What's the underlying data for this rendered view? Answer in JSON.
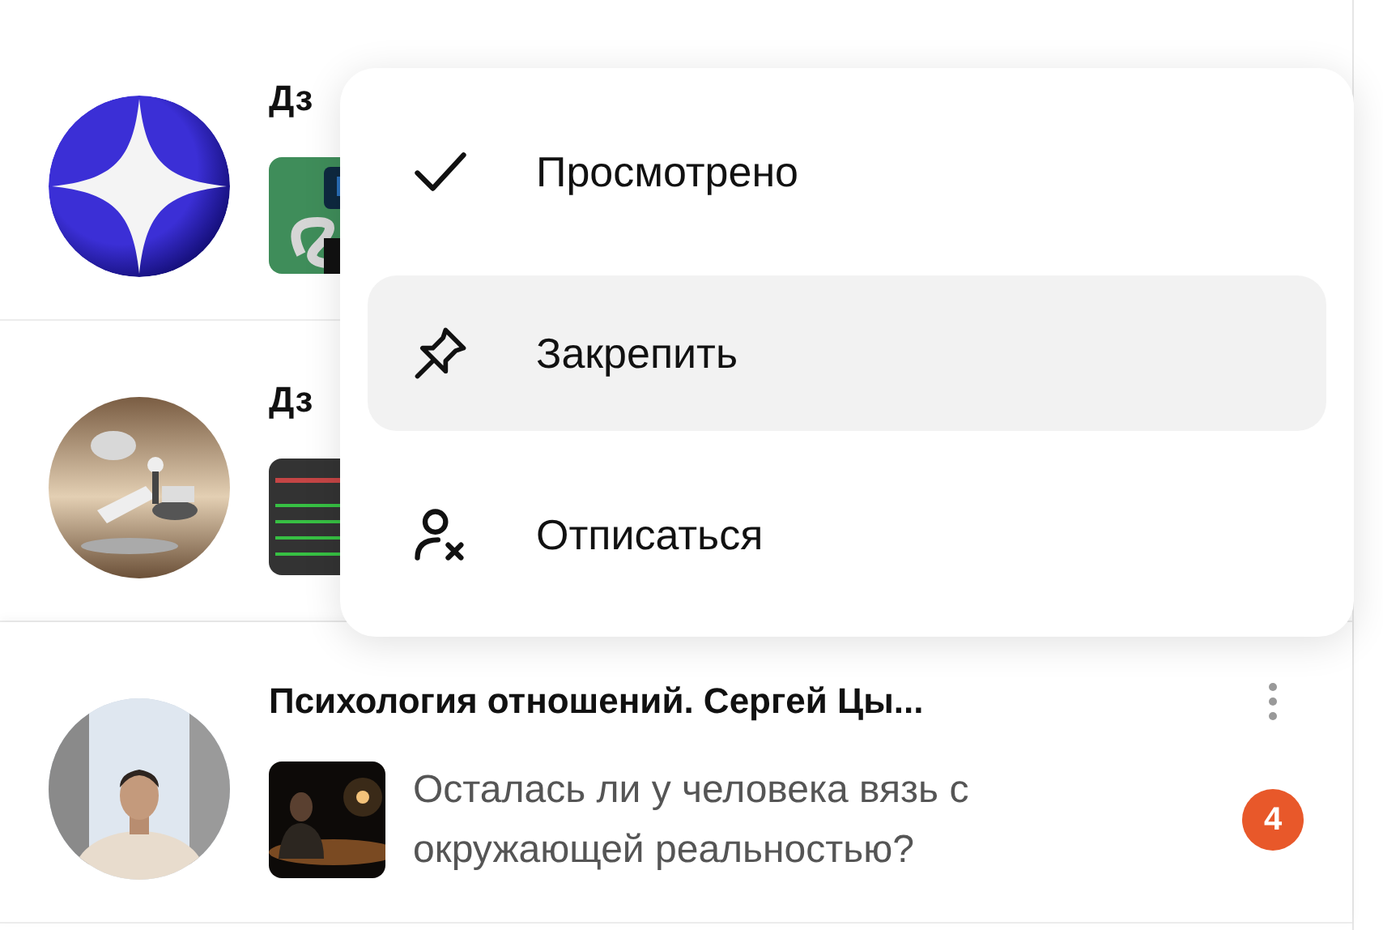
{
  "channels": [
    {
      "title": "Дз",
      "avatar": {
        "kind": "logo"
      }
    },
    {
      "title": "Дз"
    },
    {
      "title": "Психология отношений. Сергей Цы...",
      "excerpt": "Осталась ли у человека вязь с окружающей реальностью?",
      "badge": "4"
    }
  ],
  "menu": {
    "items": [
      {
        "kind": "check",
        "label": "Просмотрено",
        "selected": false
      },
      {
        "kind": "pin",
        "label": "Закрепить",
        "selected": true
      },
      {
        "kind": "unsubscribe",
        "label": "Отписаться",
        "selected": false
      }
    ]
  }
}
